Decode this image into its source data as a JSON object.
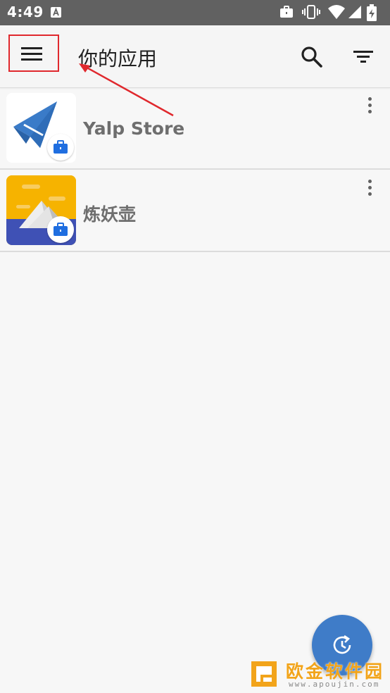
{
  "status_bar": {
    "time": "4:49",
    "icons": [
      "text-a-icon",
      "briefcase-icon",
      "vibrate-icon",
      "wifi-icon",
      "signal-icon",
      "battery-charging-icon"
    ]
  },
  "toolbar": {
    "title": "你的应用",
    "menu_icon": "hamburger-menu-icon",
    "search_icon": "search-icon",
    "filter_icon": "filter-icon"
  },
  "apps": [
    {
      "name": "Yalp Store",
      "icon": "yalp-store-icon",
      "badge": "work-briefcase-icon",
      "menu": "more-vert-icon"
    },
    {
      "name": "炼妖壶",
      "icon": "island-icon",
      "badge": "work-briefcase-icon",
      "menu": "more-vert-icon"
    }
  ],
  "fab": {
    "icon": "refresh-clock-icon"
  },
  "watermark": {
    "text": "欧金软件园",
    "url": "www.apoujin.com"
  },
  "colors": {
    "accent": "#3f7cc8",
    "status_bar": "#616161",
    "highlight_box": "#e0282d"
  }
}
